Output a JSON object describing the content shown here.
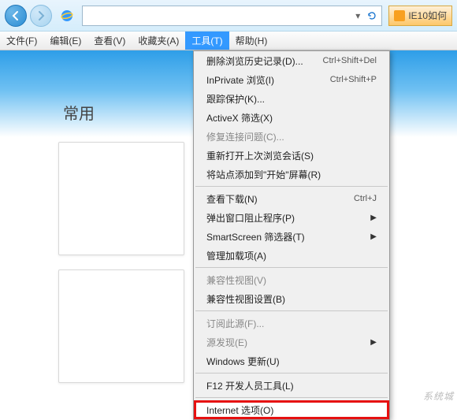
{
  "titlebar": {
    "tab_label": "IE10如何"
  },
  "menubar": {
    "items": [
      {
        "label": "文件(F)"
      },
      {
        "label": "编辑(E)"
      },
      {
        "label": "查看(V)"
      },
      {
        "label": "收藏夹(A)"
      },
      {
        "label": "工具(T)"
      },
      {
        "label": "帮助(H)"
      }
    ],
    "active_index": 4
  },
  "page": {
    "heading": "常用"
  },
  "dropdown": {
    "items": [
      {
        "label": "删除浏览历史记录(D)...",
        "shortcut": "Ctrl+Shift+Del",
        "type": "item"
      },
      {
        "label": "InPrivate 浏览(I)",
        "shortcut": "Ctrl+Shift+P",
        "type": "item"
      },
      {
        "label": "跟踪保护(K)...",
        "type": "item"
      },
      {
        "label": "ActiveX 筛选(X)",
        "type": "item"
      },
      {
        "label": "修复连接问题(C)...",
        "type": "item",
        "disabled": true
      },
      {
        "label": "重新打开上次浏览会话(S)",
        "type": "item"
      },
      {
        "label": "将站点添加到\"开始\"屏幕(R)",
        "type": "item"
      },
      {
        "type": "sep"
      },
      {
        "label": "查看下载(N)",
        "shortcut": "Ctrl+J",
        "type": "item"
      },
      {
        "label": "弹出窗口阻止程序(P)",
        "type": "submenu"
      },
      {
        "label": "SmartScreen 筛选器(T)",
        "type": "submenu"
      },
      {
        "label": "管理加载项(A)",
        "type": "item"
      },
      {
        "type": "sep"
      },
      {
        "label": "兼容性视图(V)",
        "type": "item",
        "disabled": true
      },
      {
        "label": "兼容性视图设置(B)",
        "type": "item"
      },
      {
        "type": "sep"
      },
      {
        "label": "订阅此源(F)...",
        "type": "item",
        "disabled": true
      },
      {
        "label": "源发现(E)",
        "type": "submenu",
        "disabled": true
      },
      {
        "label": "Windows 更新(U)",
        "type": "item"
      },
      {
        "type": "sep"
      },
      {
        "label": "F12 开发人员工具(L)",
        "type": "item"
      },
      {
        "type": "sep"
      },
      {
        "label": "Internet 选项(O)",
        "type": "item",
        "highlighted": true
      }
    ]
  },
  "watermark": "系统城"
}
